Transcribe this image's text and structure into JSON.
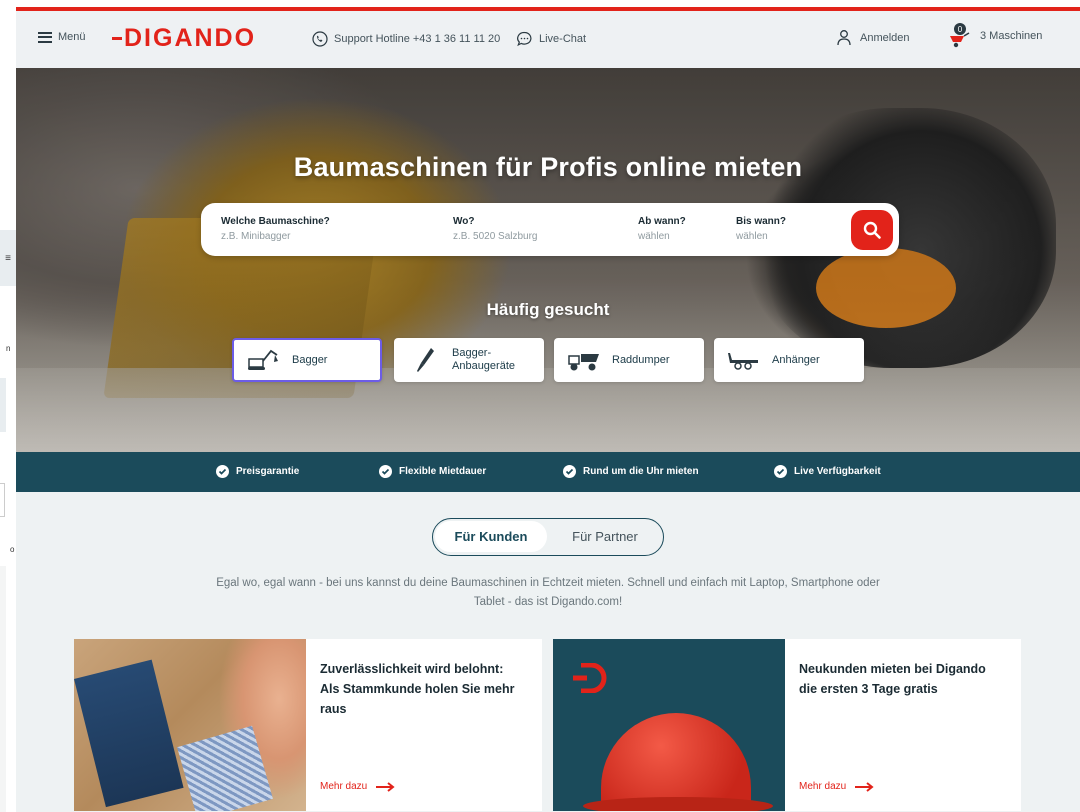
{
  "header": {
    "menu_label": "Menü",
    "logo_text": "DIGANDO",
    "hotline": "Support Hotline +43 1 36 11 11 20",
    "chat": "Live-Chat",
    "login": "Anmelden",
    "cart_count": "0",
    "cart_label": "3 Maschinen"
  },
  "hero": {
    "title": "Baumaschinen für Profis online mieten",
    "search": {
      "machine_label": "Welche Baumaschine?",
      "machine_placeholder": "z.B. Minibagger",
      "where_label": "Wo?",
      "where_placeholder": "z.B. 5020 Salzburg",
      "from_label": "Ab wann?",
      "from_placeholder": "wählen",
      "to_label": "Bis wann?",
      "to_placeholder": "wählen"
    },
    "frequent_title": "Häufig gesucht",
    "categories": [
      {
        "label": "Bagger",
        "icon": "excavator-icon"
      },
      {
        "label": "Bagger-\nAnbaugeräte",
        "icon": "breaker-icon"
      },
      {
        "label": "Raddumper",
        "icon": "dumper-icon"
      },
      {
        "label": "Anhänger",
        "icon": "trailer-icon"
      }
    ]
  },
  "usps": [
    "Preisgarantie",
    "Flexible Mietdauer",
    "Rund um die Uhr mieten",
    "Live Verfügbarkeit"
  ],
  "toggle": {
    "active": "Für Kunden",
    "inactive": "Für Partner"
  },
  "intro": "Egal wo, egal wann - bei uns kannst du deine Baumaschinen in Echtzeit mieten. Schnell und einfach mit Laptop, Smartphone oder Tablet - das ist Digando.com!",
  "cards": [
    {
      "text": "Zuverlässlichkeit wird belohnt: Als Stammkunde holen Sie mehr raus",
      "link": "Mehr dazu"
    },
    {
      "text": "Neukunden mieten bei Digando die ersten 3 Tage gratis",
      "link": "Mehr dazu"
    }
  ],
  "colors": {
    "brand_red": "#e2231a",
    "teal": "#1b4b5b",
    "accent_purple": "#6c5ce7"
  },
  "left_strip": {
    "text1": "n",
    "text2": "o"
  }
}
